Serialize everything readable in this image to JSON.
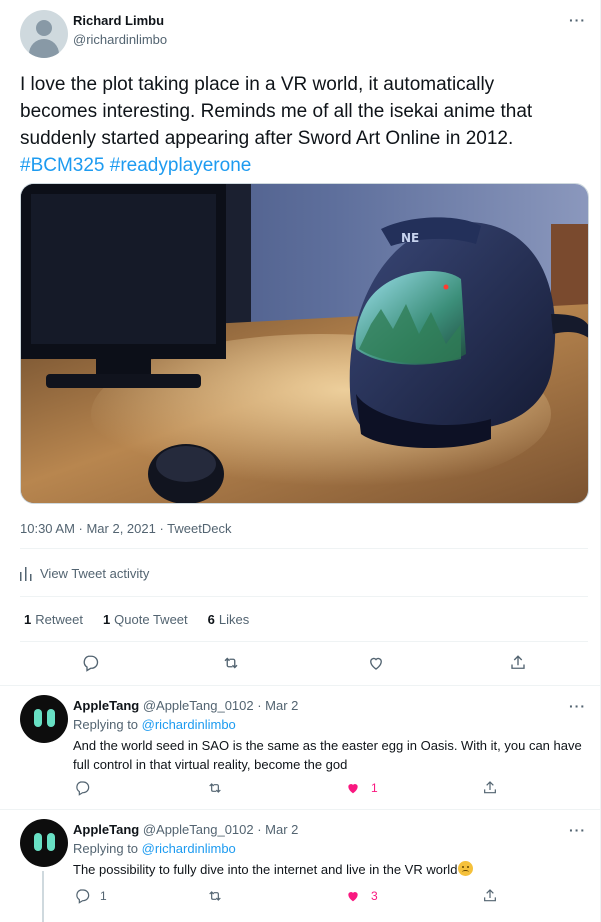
{
  "main_tweet": {
    "author_name": "Richard Limbu",
    "author_handle": "@richardinlimbo",
    "text_lines": [
      "I love the plot taking place in a VR world, it automatically",
      "becomes interesting. Reminds me of all the isekai anime that",
      "suddenly started appearing after Sword Art Online in 2012."
    ],
    "hashtags": [
      "#BCM325",
      "#readyplayerone"
    ],
    "timestamp": "10:30 AM · Mar 2, 2021 · TweetDeck",
    "activity_label": "View Tweet activity",
    "stats": [
      {
        "count": "1",
        "label": "Retweet"
      },
      {
        "count": "1",
        "label": "Quote Tweet"
      },
      {
        "count": "6",
        "label": "Likes"
      }
    ]
  },
  "replies": [
    {
      "author_name": "AppleTang",
      "author_meta": "@AppleTang_0102 · Mar 2",
      "replying_prefix": "Replying to ",
      "replying_to": "@richardinlimbo",
      "text_lines": [
        "And the world seed in SAO is the same as the easter egg in Oasis. With it, you can have",
        "full control in that virtual reality, become the god"
      ],
      "reply_count": "",
      "like_count": "1",
      "liked": true
    },
    {
      "author_name": "AppleTang",
      "author_meta": "@AppleTang_0102 · Mar 2",
      "replying_prefix": "Replying to ",
      "replying_to": "@richardinlimbo",
      "text_lines": [
        "The possibility to fully dive into the internet and live in the VR world"
      ],
      "reply_count": "1",
      "like_count": "3",
      "liked": true
    }
  ],
  "colors": {
    "accent": "#1d9bf0",
    "like": "#f91880",
    "muted": "#536471",
    "avatar_eyes": "#68e0c4"
  },
  "icons": [
    "more-icon",
    "reply-icon",
    "retweet-icon",
    "like-icon",
    "share-icon",
    "activity-icon",
    "default-avatar-icon",
    "worried-face-emoji"
  ]
}
